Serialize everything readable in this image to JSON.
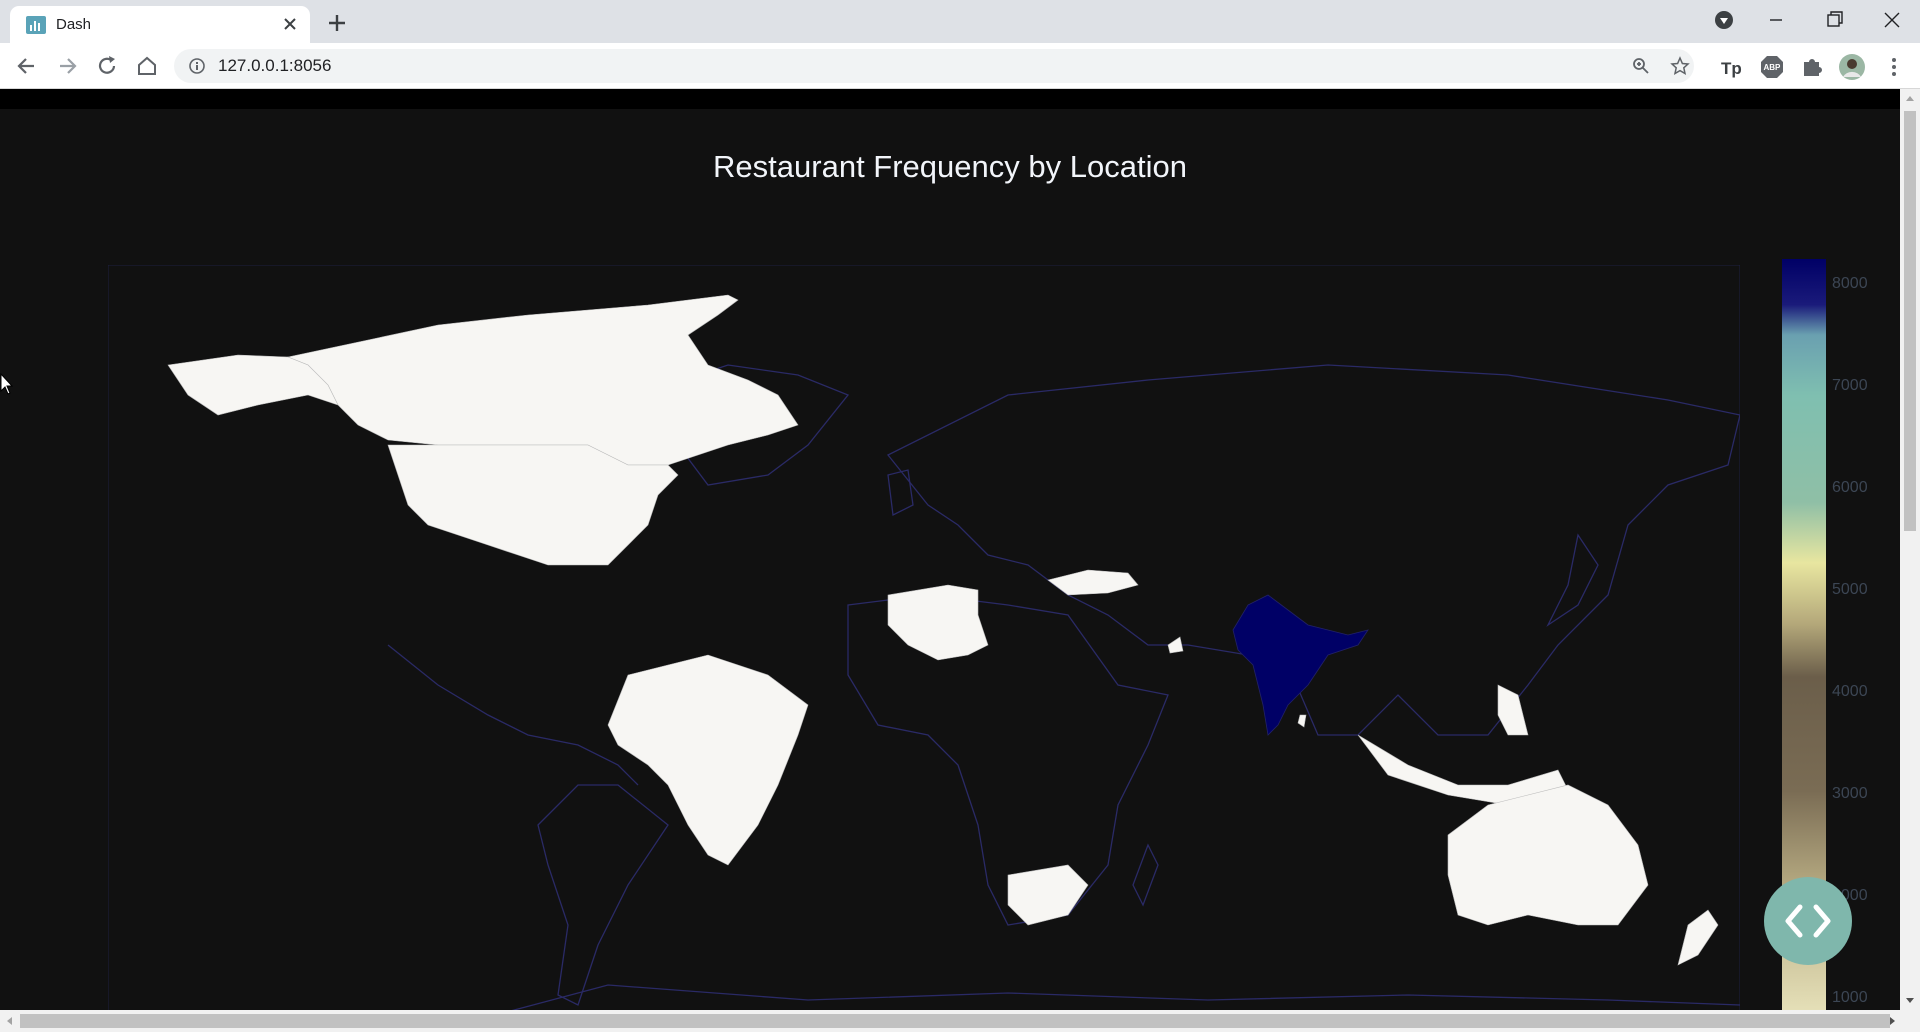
{
  "browser": {
    "tab_title": "Dash",
    "url": "127.0.0.1:8056",
    "icons": [
      "dash-favicon",
      "close-icon",
      "plus-icon",
      "media-icon",
      "minimize-icon",
      "restore-icon",
      "window-close-icon",
      "back-icon",
      "forward-icon",
      "reload-icon",
      "home-icon",
      "info-icon",
      "zoom-icon",
      "star-icon",
      "tp-extension-icon",
      "abp-extension-icon",
      "puzzle-icon",
      "profile-avatar",
      "menu-icon"
    ]
  },
  "page": {
    "chart_title": "Restaurant Frequency by Location"
  },
  "chart_data": {
    "type": "choropleth",
    "title": "Restaurant Frequency by Location",
    "colorscale": [
      "#000066",
      "#7fbfb0",
      "#e8e6a0",
      "#6b5e4a",
      "#e8e3bb"
    ],
    "colorbar": {
      "tickvals": [
        1000,
        2000,
        3000,
        4000,
        5000,
        6000,
        7000,
        8000
      ],
      "ticktext": [
        "1000",
        "2000",
        "3000",
        "4000",
        "5000",
        "6000",
        "7000",
        "8000"
      ]
    },
    "regions": [
      {
        "name": "India",
        "level": "max"
      },
      {
        "name": "Canada",
        "level": "low"
      },
      {
        "name": "United States",
        "level": "low"
      },
      {
        "name": "Brazil",
        "level": "low"
      },
      {
        "name": "South Africa",
        "level": "low"
      },
      {
        "name": "Australia",
        "level": "low"
      },
      {
        "name": "New Zealand",
        "level": "low"
      },
      {
        "name": "Indonesia",
        "level": "low"
      },
      {
        "name": "Philippines",
        "level": "low"
      },
      {
        "name": "Turkey",
        "level": "low"
      },
      {
        "name": "Algeria",
        "level": "low"
      },
      {
        "name": "United Arab Emirates",
        "level": "low"
      },
      {
        "name": "Qatar",
        "level": "low"
      },
      {
        "name": "Sri Lanka",
        "level": "low"
      },
      {
        "name": "Singapore",
        "level": "low"
      }
    ]
  }
}
